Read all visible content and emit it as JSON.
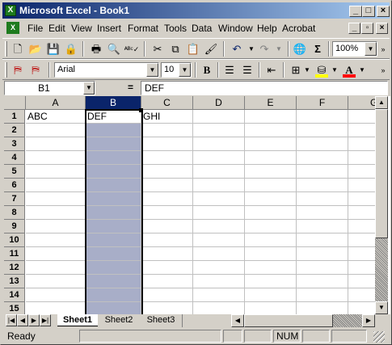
{
  "window": {
    "title": "Microsoft Excel - Book1",
    "app_icon": "X",
    "caption_buttons": [
      "_",
      "□",
      "×"
    ],
    "doc_buttons": [
      "_",
      "▫",
      "×"
    ]
  },
  "menu": {
    "items": [
      "File",
      "Edit",
      "View",
      "Insert",
      "Format",
      "Tools",
      "Data",
      "Window",
      "Help",
      "Acrobat"
    ]
  },
  "standard_toolbar": {
    "zoom": "100%",
    "icons": [
      "new-icon",
      "open-icon",
      "save-icon",
      "permission-icon",
      "print-icon",
      "print-preview-icon",
      "spelling-icon",
      "cut-icon",
      "copy-icon",
      "paste-icon",
      "format-painter-icon",
      "undo-icon",
      "redo-icon",
      "hyperlink-icon",
      "autosum-icon"
    ]
  },
  "formatting_toolbar": {
    "font": "Arial",
    "size": "10",
    "bold_label": "B",
    "font_color_label": "A",
    "colors": {
      "fill": "#ffff00",
      "font": "#ff0000"
    }
  },
  "formula_bar": {
    "name_box": "B1",
    "equals": "=",
    "value": "DEF"
  },
  "grid": {
    "columns": [
      "A",
      "B",
      "C",
      "D",
      "E",
      "F",
      "G"
    ],
    "selected_column": "B",
    "rows": [
      "1",
      "2",
      "3",
      "4",
      "5",
      "6",
      "7",
      "8",
      "9",
      "10",
      "11",
      "12",
      "13",
      "14",
      "15"
    ],
    "cells": {
      "A1": "ABC",
      "B1": "DEF",
      "C1": "GHI"
    }
  },
  "sheets": {
    "tabs": [
      "Sheet1",
      "Sheet2",
      "Sheet3"
    ],
    "active": "Sheet1"
  },
  "status": {
    "text": "Ready",
    "num": "NUM"
  },
  "colors": {
    "title_gradient_start": "#0a246a",
    "selection": "#a8aec8",
    "chrome": "#d4d0c8"
  }
}
